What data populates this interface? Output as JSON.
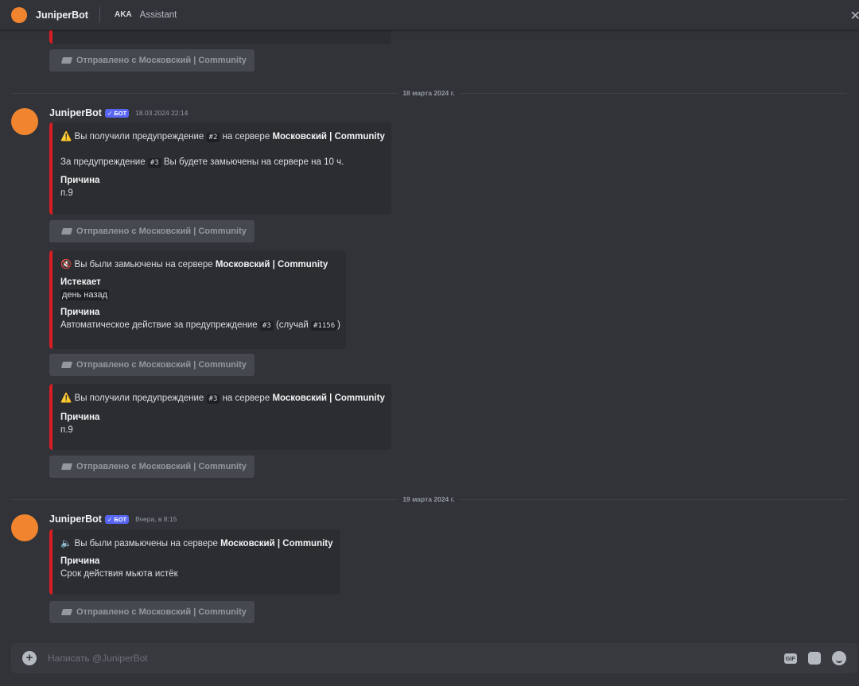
{
  "header": {
    "bot_name": "JuniperBot",
    "aka_label": "AKA",
    "aka_name": "Assistant",
    "close_glyph": "✕"
  },
  "sent_button_label": "Отправлено с Московский | Community",
  "bot_tag": "✓ БОТ",
  "dividers": [
    "18 марта 2024 г.",
    "19 марта 2024 г."
  ],
  "messages": [
    {
      "author": "JuniperBot",
      "timestamp": "18.03.2024 22:14"
    },
    {
      "author": "JuniperBot",
      "timestamp": "Вчера, в 8:15"
    }
  ],
  "embeds": {
    "warn2": {
      "icon": "⚠️",
      "title_pre": "Вы получили предупреждение",
      "code": "#2",
      "title_mid": "на сервере",
      "server": "Московский | Community",
      "desc_pre": "За предупреждение",
      "desc_code": "#3",
      "desc_post": "Вы будете замьючены на сервере на 10 ч.",
      "field_name": "Причина",
      "field_value": "п.9"
    },
    "mute": {
      "icon": "🔇",
      "title_pre": "Вы были замьючены на сервере",
      "server": "Московский | Community",
      "f1_name": "Истекает",
      "f1_value": "день назад",
      "f2_name": "Причина",
      "f2_pre": "Автоматическое действие за предупреждение",
      "f2_code1": "#3",
      "f2_mid": "(случай",
      "f2_code2": "#1156",
      "f2_post": ")"
    },
    "warn3": {
      "icon": "⚠️",
      "title_pre": "Вы получили предупреждение",
      "code": "#3",
      "title_mid": "на сервере",
      "server": "Московский | Community",
      "field_name": "Причина",
      "field_value": "п.9"
    },
    "unmute": {
      "icon": "🔈",
      "title_pre": "Вы были размьючены на сервере",
      "server": "Московский | Community",
      "field_name": "Причина",
      "field_value": "Срок действия мьюта истёк"
    }
  },
  "composer": {
    "placeholder": "Написать @JuniperBot",
    "gif_label": "GIF"
  },
  "colors": {
    "accent_red": "#da1d22",
    "bot_tag": "#5865f2",
    "avatar": "#f0842f"
  }
}
